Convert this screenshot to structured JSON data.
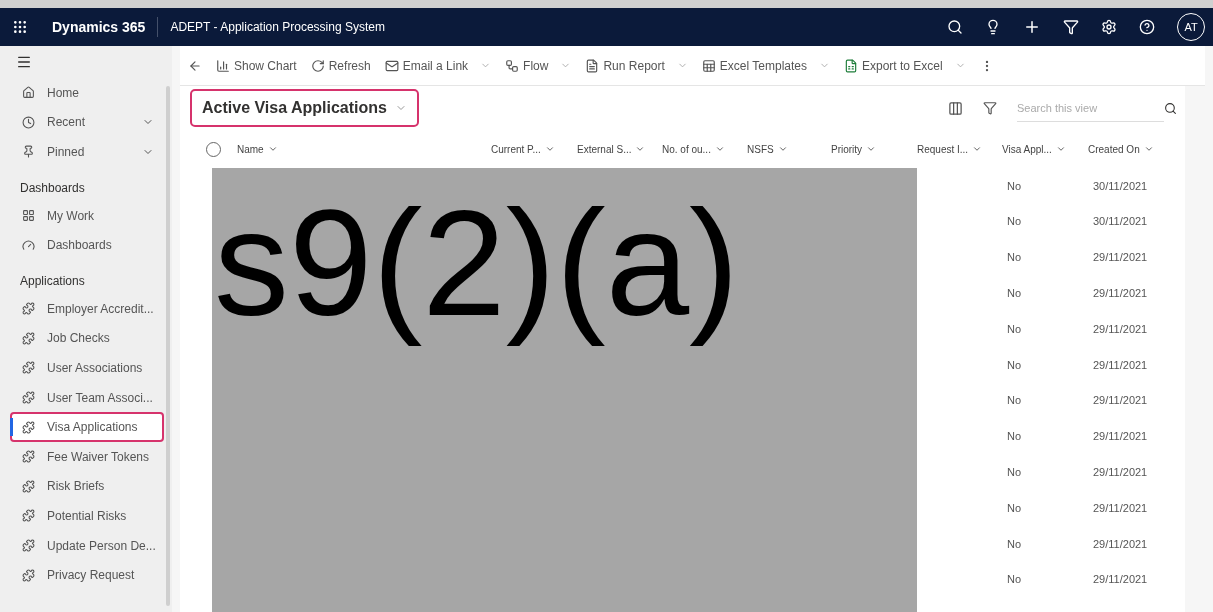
{
  "header": {
    "app_name": "Dynamics 365",
    "title": "ADEPT - Application Processing System",
    "avatar": "AT"
  },
  "sidebar": {
    "items": [
      {
        "kind": "item",
        "label": "Home",
        "selected": false,
        "expandable": false
      },
      {
        "kind": "item",
        "label": "Recent",
        "selected": false,
        "expandable": true
      },
      {
        "kind": "item",
        "label": "Pinned",
        "selected": false,
        "expandable": true
      },
      {
        "kind": "section",
        "label": "Dashboards"
      },
      {
        "kind": "item",
        "label": "My Work",
        "selected": false
      },
      {
        "kind": "item",
        "label": "Dashboards",
        "selected": false
      },
      {
        "kind": "section",
        "label": "Applications"
      },
      {
        "kind": "item",
        "label": "Employer Accredit...",
        "selected": false,
        "highlighted": false
      },
      {
        "kind": "item",
        "label": "Job Checks",
        "selected": false,
        "highlighted": false
      },
      {
        "kind": "item",
        "label": "User Associations",
        "selected": false,
        "highlighted": false
      },
      {
        "kind": "item",
        "label": "User Team Associ...",
        "selected": false,
        "highlighted": false
      },
      {
        "kind": "item",
        "label": "Visa Applications",
        "selected": true,
        "highlighted": true
      },
      {
        "kind": "item",
        "label": "Fee Waiver Tokens",
        "selected": false,
        "highlighted": false
      },
      {
        "kind": "item",
        "label": "Risk Briefs",
        "selected": false,
        "highlighted": false
      },
      {
        "kind": "item",
        "label": "Potential Risks",
        "selected": false,
        "highlighted": false
      },
      {
        "kind": "item",
        "label": "Update Person De...",
        "selected": false,
        "highlighted": false
      },
      {
        "kind": "item",
        "label": "Privacy Request",
        "selected": false,
        "highlighted": false
      }
    ]
  },
  "toolbar": [
    {
      "label": "Show Chart",
      "dropdown": false
    },
    {
      "label": "Refresh",
      "dropdown": false
    },
    {
      "label": "Email a Link",
      "dropdown": true
    },
    {
      "label": "Flow",
      "dropdown": true
    },
    {
      "label": "Run Report",
      "dropdown": true
    },
    {
      "label": "Excel Templates",
      "dropdown": true
    },
    {
      "label": "Export to Excel",
      "dropdown": true
    }
  ],
  "view": {
    "title": "Active Visa Applications",
    "highlighted": true,
    "search_placeholder": "Search this view"
  },
  "table": {
    "select_all_checked": false,
    "columns": [
      "Name",
      "Current P...",
      "External S...",
      "No. of ou...",
      "NSFS",
      "Priority",
      "Request I...",
      "Visa Appl...",
      "Created On"
    ],
    "rows": [
      {
        "visa_appl": "No",
        "created_on": "30/11/2021"
      },
      {
        "visa_appl": "No",
        "created_on": "30/11/2021"
      },
      {
        "visa_appl": "No",
        "created_on": "29/11/2021"
      },
      {
        "visa_appl": "No",
        "created_on": "29/11/2021"
      },
      {
        "visa_appl": "No",
        "created_on": "29/11/2021"
      },
      {
        "visa_appl": "No",
        "created_on": "29/11/2021"
      },
      {
        "visa_appl": "No",
        "created_on": "29/11/2021"
      },
      {
        "visa_appl": "No",
        "created_on": "29/11/2021"
      },
      {
        "visa_appl": "No",
        "created_on": "29/11/2021"
      },
      {
        "visa_appl": "No",
        "created_on": "29/11/2021"
      },
      {
        "visa_appl": "No",
        "created_on": "29/11/2021"
      },
      {
        "visa_appl": "No",
        "created_on": "29/11/2021"
      }
    ]
  },
  "redaction": {
    "label": "s9(2)(a)"
  }
}
